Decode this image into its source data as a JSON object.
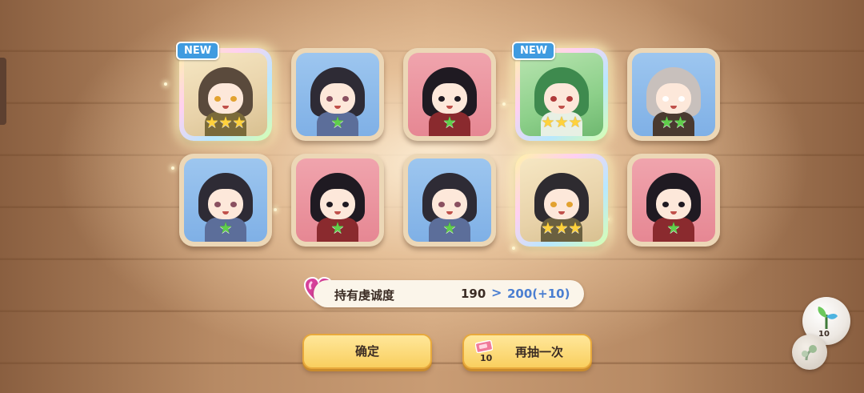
{
  "screen": {
    "cards": [
      {
        "frame": "rainbow",
        "rarity": 3,
        "star_color": "gold",
        "is_new": true,
        "hair": "#5a4a3c",
        "outfit": "#7a6a3a",
        "eyes": "#e2a230"
      },
      {
        "frame": "blue",
        "rarity": 1,
        "star_color": "green",
        "is_new": false,
        "hair": "#2e2b35",
        "outfit": "#5c6e9a",
        "eyes": "#8a5060"
      },
      {
        "frame": "pink",
        "rarity": 1,
        "star_color": "green",
        "is_new": false,
        "hair": "#1f1a22",
        "outfit": "#8a2a2e",
        "eyes": "#1f1a22"
      },
      {
        "frame": "rainbow-green",
        "rarity": 3,
        "star_color": "gold",
        "is_new": true,
        "hair": "#3e8a4e",
        "outfit": "#e8f0e4",
        "eyes": "#b03a3a"
      },
      {
        "frame": "blue",
        "rarity": 2,
        "star_color": "green",
        "is_new": false,
        "hair": "#c8c0bc",
        "outfit": "#4a3a30",
        "eyes": "#ffffff"
      },
      {
        "frame": "blue",
        "rarity": 1,
        "star_color": "green",
        "is_new": false,
        "hair": "#2e2b35",
        "outfit": "#5c6e9a",
        "eyes": "#8a5060"
      },
      {
        "frame": "pink",
        "rarity": 1,
        "star_color": "green",
        "is_new": false,
        "hair": "#1f1a22",
        "outfit": "#8a2a2e",
        "eyes": "#1f1a22"
      },
      {
        "frame": "blue",
        "rarity": 1,
        "star_color": "green",
        "is_new": false,
        "hair": "#2e2b35",
        "outfit": "#5c6e9a",
        "eyes": "#8a5060"
      },
      {
        "frame": "rainbow",
        "rarity": 3,
        "star_color": "gold",
        "is_new": false,
        "hair": "#2e2b30",
        "outfit": "#6a6040",
        "eyes": "#e2a230"
      },
      {
        "frame": "pink",
        "rarity": 1,
        "star_color": "green",
        "is_new": false,
        "hair": "#1f1a22",
        "outfit": "#8a2a2e",
        "eyes": "#1f1a22"
      }
    ],
    "new_badge_label": "NEW",
    "devotion": {
      "label": "持有虔诚度",
      "current": "190",
      "arrow": ">",
      "after": "200(+10)",
      "icon": "heart-gem-icon"
    },
    "buttons": {
      "confirm_label": "确定",
      "redraw_label": "再抽一次",
      "redraw_ticket_count": "10",
      "redraw_icon": "ticket-icon"
    },
    "side_item": {
      "count": "10",
      "icon": "sprout-orb-icon"
    },
    "colors": {
      "gold_star": "#ffd23c",
      "green_star": "#5fcf4a",
      "button_yellow": "#f9cf5f",
      "value_blue": "#4b7fd1",
      "badge_blue": "#3f9be0"
    }
  }
}
